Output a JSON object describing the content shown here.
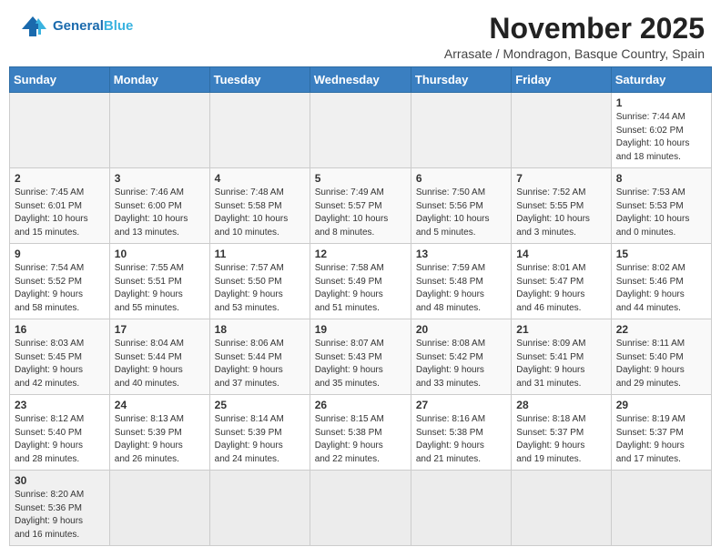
{
  "header": {
    "logo_general": "General",
    "logo_blue": "Blue",
    "title": "November 2025",
    "subtitle": "Arrasate / Mondragon, Basque Country, Spain"
  },
  "days_of_week": [
    "Sunday",
    "Monday",
    "Tuesday",
    "Wednesday",
    "Thursday",
    "Friday",
    "Saturday"
  ],
  "weeks": [
    [
      {
        "num": "",
        "info": ""
      },
      {
        "num": "",
        "info": ""
      },
      {
        "num": "",
        "info": ""
      },
      {
        "num": "",
        "info": ""
      },
      {
        "num": "",
        "info": ""
      },
      {
        "num": "",
        "info": ""
      },
      {
        "num": "1",
        "info": "Sunrise: 7:44 AM\nSunset: 6:02 PM\nDaylight: 10 hours\nand 18 minutes."
      }
    ],
    [
      {
        "num": "2",
        "info": "Sunrise: 7:45 AM\nSunset: 6:01 PM\nDaylight: 10 hours\nand 15 minutes."
      },
      {
        "num": "3",
        "info": "Sunrise: 7:46 AM\nSunset: 6:00 PM\nDaylight: 10 hours\nand 13 minutes."
      },
      {
        "num": "4",
        "info": "Sunrise: 7:48 AM\nSunset: 5:58 PM\nDaylight: 10 hours\nand 10 minutes."
      },
      {
        "num": "5",
        "info": "Sunrise: 7:49 AM\nSunset: 5:57 PM\nDaylight: 10 hours\nand 8 minutes."
      },
      {
        "num": "6",
        "info": "Sunrise: 7:50 AM\nSunset: 5:56 PM\nDaylight: 10 hours\nand 5 minutes."
      },
      {
        "num": "7",
        "info": "Sunrise: 7:52 AM\nSunset: 5:55 PM\nDaylight: 10 hours\nand 3 minutes."
      },
      {
        "num": "8",
        "info": "Sunrise: 7:53 AM\nSunset: 5:53 PM\nDaylight: 10 hours\nand 0 minutes."
      }
    ],
    [
      {
        "num": "9",
        "info": "Sunrise: 7:54 AM\nSunset: 5:52 PM\nDaylight: 9 hours\nand 58 minutes."
      },
      {
        "num": "10",
        "info": "Sunrise: 7:55 AM\nSunset: 5:51 PM\nDaylight: 9 hours\nand 55 minutes."
      },
      {
        "num": "11",
        "info": "Sunrise: 7:57 AM\nSunset: 5:50 PM\nDaylight: 9 hours\nand 53 minutes."
      },
      {
        "num": "12",
        "info": "Sunrise: 7:58 AM\nSunset: 5:49 PM\nDaylight: 9 hours\nand 51 minutes."
      },
      {
        "num": "13",
        "info": "Sunrise: 7:59 AM\nSunset: 5:48 PM\nDaylight: 9 hours\nand 48 minutes."
      },
      {
        "num": "14",
        "info": "Sunrise: 8:01 AM\nSunset: 5:47 PM\nDaylight: 9 hours\nand 46 minutes."
      },
      {
        "num": "15",
        "info": "Sunrise: 8:02 AM\nSunset: 5:46 PM\nDaylight: 9 hours\nand 44 minutes."
      }
    ],
    [
      {
        "num": "16",
        "info": "Sunrise: 8:03 AM\nSunset: 5:45 PM\nDaylight: 9 hours\nand 42 minutes."
      },
      {
        "num": "17",
        "info": "Sunrise: 8:04 AM\nSunset: 5:44 PM\nDaylight: 9 hours\nand 40 minutes."
      },
      {
        "num": "18",
        "info": "Sunrise: 8:06 AM\nSunset: 5:44 PM\nDaylight: 9 hours\nand 37 minutes."
      },
      {
        "num": "19",
        "info": "Sunrise: 8:07 AM\nSunset: 5:43 PM\nDaylight: 9 hours\nand 35 minutes."
      },
      {
        "num": "20",
        "info": "Sunrise: 8:08 AM\nSunset: 5:42 PM\nDaylight: 9 hours\nand 33 minutes."
      },
      {
        "num": "21",
        "info": "Sunrise: 8:09 AM\nSunset: 5:41 PM\nDaylight: 9 hours\nand 31 minutes."
      },
      {
        "num": "22",
        "info": "Sunrise: 8:11 AM\nSunset: 5:40 PM\nDaylight: 9 hours\nand 29 minutes."
      }
    ],
    [
      {
        "num": "23",
        "info": "Sunrise: 8:12 AM\nSunset: 5:40 PM\nDaylight: 9 hours\nand 28 minutes."
      },
      {
        "num": "24",
        "info": "Sunrise: 8:13 AM\nSunset: 5:39 PM\nDaylight: 9 hours\nand 26 minutes."
      },
      {
        "num": "25",
        "info": "Sunrise: 8:14 AM\nSunset: 5:39 PM\nDaylight: 9 hours\nand 24 minutes."
      },
      {
        "num": "26",
        "info": "Sunrise: 8:15 AM\nSunset: 5:38 PM\nDaylight: 9 hours\nand 22 minutes."
      },
      {
        "num": "27",
        "info": "Sunrise: 8:16 AM\nSunset: 5:38 PM\nDaylight: 9 hours\nand 21 minutes."
      },
      {
        "num": "28",
        "info": "Sunrise: 8:18 AM\nSunset: 5:37 PM\nDaylight: 9 hours\nand 19 minutes."
      },
      {
        "num": "29",
        "info": "Sunrise: 8:19 AM\nSunset: 5:37 PM\nDaylight: 9 hours\nand 17 minutes."
      }
    ],
    [
      {
        "num": "30",
        "info": "Sunrise: 8:20 AM\nSunset: 5:36 PM\nDaylight: 9 hours\nand 16 minutes."
      },
      {
        "num": "",
        "info": ""
      },
      {
        "num": "",
        "info": ""
      },
      {
        "num": "",
        "info": ""
      },
      {
        "num": "",
        "info": ""
      },
      {
        "num": "",
        "info": ""
      },
      {
        "num": "",
        "info": ""
      }
    ]
  ]
}
